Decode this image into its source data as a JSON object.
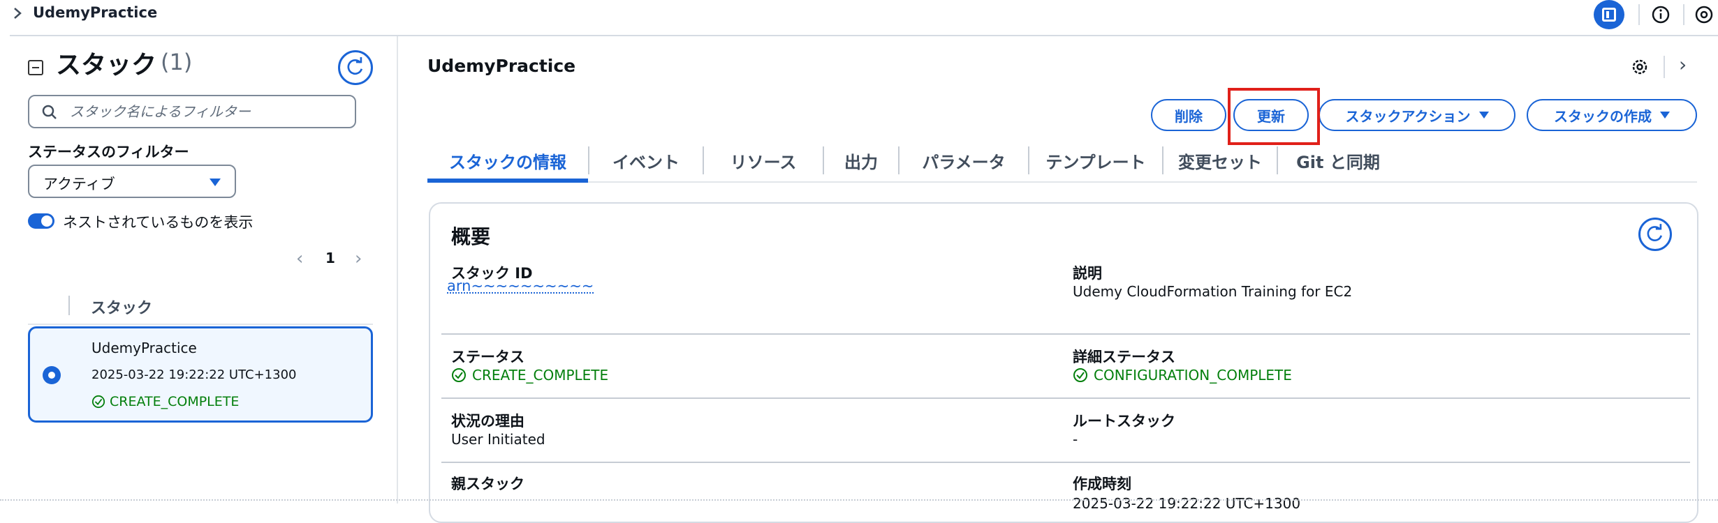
{
  "breadcrumb": {
    "title": "UdemyPractice"
  },
  "colors": {
    "accent": "#1a64d6",
    "success": "#037f0c",
    "highlight": "#e0201a"
  },
  "left_panel": {
    "heading": "スタック",
    "count": "(1)",
    "search": {
      "placeholder": "スタック名によるフィルター",
      "value": ""
    },
    "status_filter_label": "ステータスのフィルター",
    "status_filter_value": "アクティブ",
    "nested_toggle_label": "ネストされているものを表示",
    "nested_toggle_on": true,
    "pager": {
      "page": "1",
      "prev": "‹",
      "next": "›"
    },
    "column_header": "スタック",
    "stacks": [
      {
        "name": "UdemyPractice",
        "created": "2025-03-22 19:22:22 UTC+1300",
        "status": "CREATE_COMPLETE",
        "selected": true
      }
    ]
  },
  "main": {
    "title": "UdemyPractice",
    "buttons": {
      "delete": "削除",
      "update": "更新",
      "stack_actions": "スタックアクション",
      "create_stack": "スタックの作成"
    },
    "tabs": [
      "スタックの情報",
      "イベント",
      "リソース",
      "出力",
      "パラメータ",
      "テンプレート",
      "変更セット",
      "Git と同期"
    ],
    "active_tab": 0,
    "overview": {
      "title": "概要",
      "stack_id_label": "スタック ID",
      "stack_id_value": "arn~~~~~~~~~~",
      "description_label": "説明",
      "description_value": "Udemy CloudFormation Training for EC2",
      "status_label": "ステータス",
      "status_value": "CREATE_COMPLETE",
      "detailed_status_label": "詳細ステータス",
      "detailed_status_value": "CONFIGURATION_COMPLETE",
      "reason_label": "状況の理由",
      "reason_value": "User Initiated",
      "root_stack_label": "ルートスタック",
      "root_stack_value": "-",
      "parent_stack_label": "親スタック",
      "created_time_label": "作成時刻",
      "created_time_value": "2025-03-22 19:22:22 UTC+1300"
    }
  }
}
